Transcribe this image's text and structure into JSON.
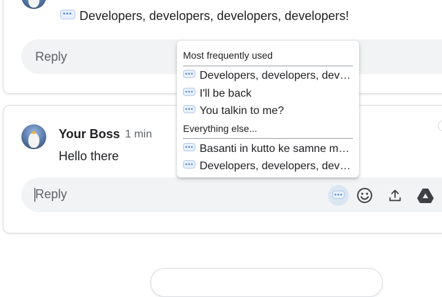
{
  "message1": {
    "text": "Developers, developers, developers, developers!",
    "reply_placeholder": "Reply"
  },
  "message2": {
    "author": "Your Boss",
    "time": "1 min",
    "text": "Hello there",
    "reply_placeholder": "Reply"
  },
  "menu": {
    "section_frequent": "Most frequently used",
    "frequent_items": [
      "Developers, developers, developers, developers!",
      "I'll be back",
      "You talkin to me?"
    ],
    "section_else": "Everything else...",
    "else_items": [
      "Basanti in kutto ke samne mat nachna",
      "Developers, developers, developers, developers!"
    ]
  },
  "icons": {
    "quick_reply": "speech-bubble-icon",
    "emoji": "smiley-icon",
    "upload": "upload-icon",
    "drive": "drive-icon"
  }
}
